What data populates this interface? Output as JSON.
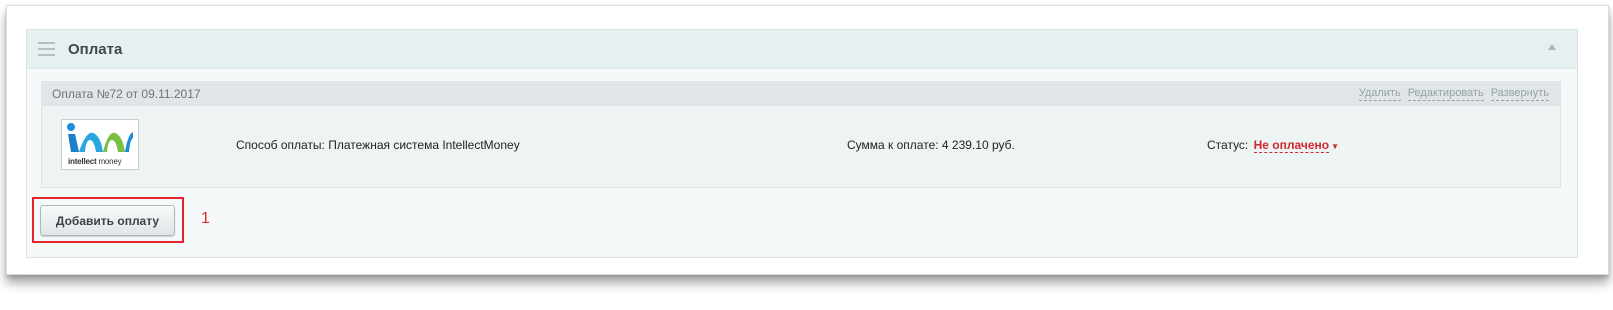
{
  "section": {
    "title": "Оплата"
  },
  "payment": {
    "header_title": "Оплата №72 от 09.11.2017",
    "actions": {
      "delete": "Удалить",
      "edit": "Редактировать",
      "expand": "Развернуть"
    },
    "logo": {
      "brand_bold": "intellect",
      "brand_rest": " money"
    },
    "method_text": "Способ оплаты: Платежная система IntellectMoney",
    "amount_text": "Сумма к оплате: 4 239.10 руб.",
    "status_label": "Статус:",
    "status_value": "Не оплачено",
    "status_color": "#d0282f"
  },
  "add_payment_button": "Добавить оплату",
  "annotation": {
    "number": "1",
    "color": "#e4262b"
  }
}
